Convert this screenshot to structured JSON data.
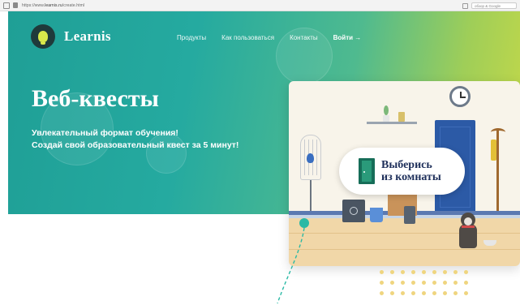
{
  "browser": {
    "url_prefix": "https://www.",
    "url_host": "learnis.ru",
    "url_path": "/create.html",
    "search_placeholder": "обзор & Google"
  },
  "header": {
    "logo_text": "Learnis",
    "nav": [
      {
        "label": "Продукты"
      },
      {
        "label": "Как пользоваться"
      },
      {
        "label": "Контакты"
      },
      {
        "label": "Войти →"
      }
    ]
  },
  "hero": {
    "title": "Веб-квесты",
    "subtitle_line1": "Увлекательный формат обучения!",
    "subtitle_line2": "Создай свой образовательный квест за 5 минут!"
  },
  "illustration": {
    "pill_line1": "Выберись",
    "pill_line2": "из комнаты"
  },
  "colors": {
    "hero_start": "#1f9f96",
    "hero_end": "#c6d948",
    "logo_bg": "#1f3a3b",
    "logo_bulb": "#d9e84b",
    "pill_text": "#1e2f5a",
    "accent_teal": "#2ab9a5"
  },
  "icons": [
    "lightbulb-logo-icon",
    "door-icon",
    "clock-icon",
    "lock-icon"
  ]
}
